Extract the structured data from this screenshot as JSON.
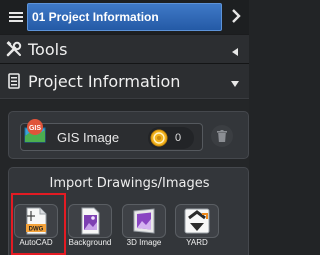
{
  "top_tab": {
    "label": "01 Project Information"
  },
  "sections": {
    "tools": {
      "title": "Tools"
    },
    "project_info": {
      "title": "Project Information"
    }
  },
  "gis": {
    "label": "GIS Image",
    "badge": "GIS",
    "count": "0"
  },
  "import": {
    "title": "Import Drawings/Images",
    "items": [
      {
        "label": "AutoCAD",
        "badge": "DWG"
      },
      {
        "label": "Background"
      },
      {
        "label": "3D Image"
      },
      {
        "label": "YARD"
      }
    ]
  },
  "colors": {
    "tab": "#2f68b5",
    "highlight": "#e31b23",
    "panel": "#33363a",
    "background": "#222426"
  }
}
